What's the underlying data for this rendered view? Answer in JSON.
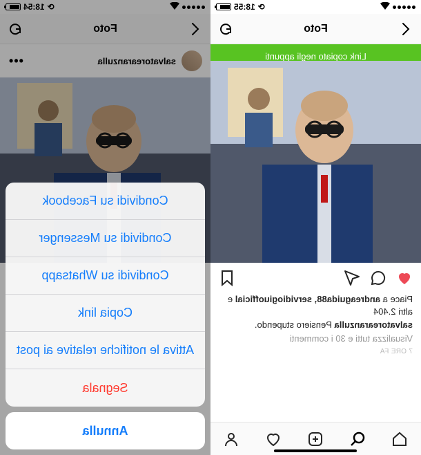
{
  "left": {
    "status": {
      "time": "18:55",
      "carrier_indicator": "⟳"
    },
    "header": {
      "title": "Foto"
    },
    "toast": "Link copiato negli appunti",
    "likes_line_prefix": "Piace a ",
    "likes_line_bold": "andreaguida88, servidiogiuofficial",
    "likes_line_suffix": " e altri 2.404",
    "caption_user": "salvatorearanzulla",
    "caption_text": " Pensiero stupendo.",
    "view_comments": "Visualizza tutti e 30 i commenti",
    "timestamp": "7 ORE FA"
  },
  "right": {
    "status": {
      "time": "18:54",
      "carrier_indicator": "⟳"
    },
    "header": {
      "title": "Foto"
    },
    "user_row": {
      "username": "salvatorearanzulla"
    },
    "sheet": {
      "items": [
        {
          "label": "Condividi su Facebook",
          "style": "normal"
        },
        {
          "label": "Condividi su Messenger",
          "style": "normal"
        },
        {
          "label": "Condividi su Whatsapp",
          "style": "normal"
        },
        {
          "label": "Copia link",
          "style": "normal"
        },
        {
          "label": "Attiva le notifiche relative ai post",
          "style": "normal"
        },
        {
          "label": "Segnala",
          "style": "destructive"
        }
      ],
      "cancel": "Annulla"
    }
  },
  "icons": {
    "back": "chevron-left",
    "refresh": "refresh",
    "more": "more-horizontal",
    "heart": "heart",
    "comment": "comment",
    "send": "send",
    "bookmark": "bookmark",
    "home": "home",
    "search": "search",
    "add": "plus-square",
    "activity": "heart-outline",
    "profile": "person"
  }
}
